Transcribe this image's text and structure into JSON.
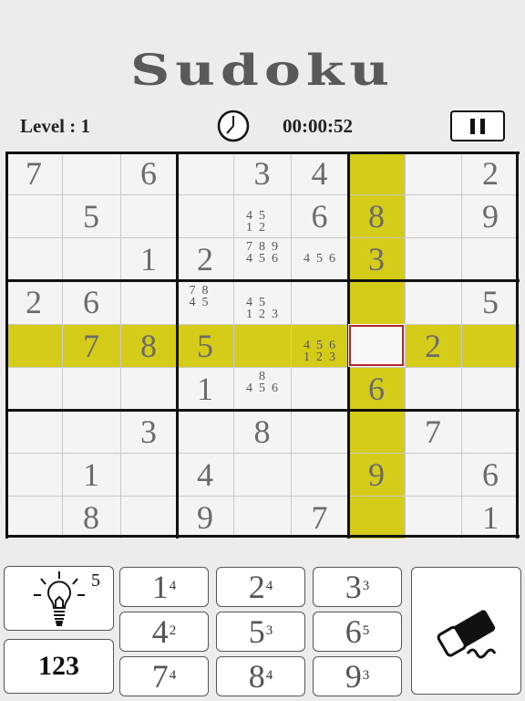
{
  "title": "Sudoku",
  "level_label": "Level : 1",
  "timer": "00:00:52",
  "icons": {
    "clock": "clock-icon",
    "pause": "pause-icon",
    "hint": "lightbulb-icon",
    "eraser": "eraser-icon"
  },
  "colors": {
    "highlight": "#d5cc1a",
    "selected_border": "#b3262b",
    "digit": "#6b6b6b"
  },
  "board": {
    "values": [
      "7",
      "",
      "6",
      "",
      "3",
      "4",
      "",
      "",
      "2",
      "",
      "5",
      "",
      "",
      "",
      "6",
      "8",
      "",
      "9",
      "",
      "",
      "1",
      "2",
      "",
      "",
      "3",
      "",
      "",
      "2",
      "6",
      "",
      "",
      "",
      "",
      "",
      "",
      "5",
      "",
      "7",
      "8",
      "5",
      "",
      "",
      "",
      "2",
      "",
      "",
      "",
      "",
      "1",
      "",
      "",
      "6",
      "",
      "",
      "",
      "",
      "3",
      "",
      "8",
      "",
      "",
      "7",
      "",
      "",
      "1",
      "",
      "4",
      "",
      "",
      "9",
      "",
      "6",
      "",
      "8",
      "",
      "9",
      "",
      "7",
      "",
      "",
      "1"
    ],
    "notes": {
      "13": [
        "",
        "",
        "",
        "4",
        "5",
        "",
        "1",
        "2",
        ""
      ],
      "22": [
        "7",
        "8",
        "9",
        "4",
        "5",
        "6",
        "",
        "",
        ""
      ],
      "23": [
        "",
        "",
        "",
        "4",
        "5",
        "6",
        "",
        "",
        ""
      ],
      "30": [
        "7",
        "8",
        "",
        "4",
        "5",
        "",
        "",
        "",
        ""
      ],
      "31": [
        "",
        "",
        "",
        "4",
        "5",
        "",
        "1",
        "2",
        "3"
      ],
      "41": [
        "",
        "",
        "",
        "4",
        "5",
        "6",
        "1",
        "2",
        "3"
      ],
      "49": [
        "",
        "8",
        "",
        "4",
        "5",
        "6",
        "",
        "",
        ""
      ]
    },
    "selected": [
      4,
      6
    ],
    "highlight_row": 4,
    "highlight_col": 6
  },
  "hint": {
    "count": "5"
  },
  "mode_toggle": {
    "label": "123"
  },
  "keypad": [
    {
      "digit": "1",
      "count": "4"
    },
    {
      "digit": "2",
      "count": "4"
    },
    {
      "digit": "3",
      "count": "3"
    },
    {
      "digit": "4",
      "count": "2"
    },
    {
      "digit": "5",
      "count": "3"
    },
    {
      "digit": "6",
      "count": "5"
    },
    {
      "digit": "7",
      "count": "4"
    },
    {
      "digit": "8",
      "count": "4"
    },
    {
      "digit": "9",
      "count": "3"
    }
  ]
}
